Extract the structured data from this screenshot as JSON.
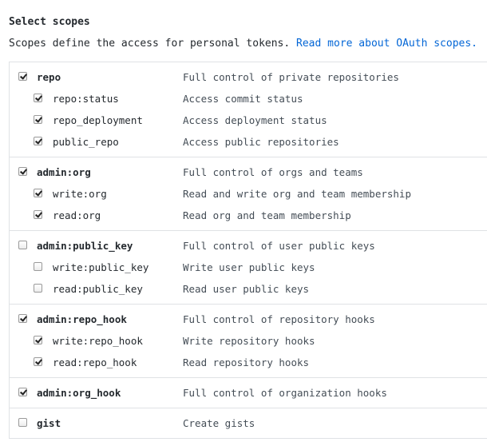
{
  "heading": "Select scopes",
  "description": {
    "text": "Scopes define the access for personal tokens.",
    "link": "Read more about OAuth scopes."
  },
  "scopes": [
    {
      "name": "repo",
      "description": "Full control of private repositories",
      "checked": true,
      "children": [
        {
          "name": "repo:status",
          "description": "Access commit status",
          "checked": true
        },
        {
          "name": "repo_deployment",
          "description": "Access deployment status",
          "checked": true
        },
        {
          "name": "public_repo",
          "description": "Access public repositories",
          "checked": true
        }
      ]
    },
    {
      "name": "admin:org",
      "description": "Full control of orgs and teams",
      "checked": true,
      "children": [
        {
          "name": "write:org",
          "description": "Read and write org and team membership",
          "checked": true
        },
        {
          "name": "read:org",
          "description": "Read org and team membership",
          "checked": true
        }
      ]
    },
    {
      "name": "admin:public_key",
      "description": "Full control of user public keys",
      "checked": false,
      "children": [
        {
          "name": "write:public_key",
          "description": "Write user public keys",
          "checked": false
        },
        {
          "name": "read:public_key",
          "description": "Read user public keys",
          "checked": false
        }
      ]
    },
    {
      "name": "admin:repo_hook",
      "description": "Full control of repository hooks",
      "checked": true,
      "children": [
        {
          "name": "write:repo_hook",
          "description": "Write repository hooks",
          "checked": true
        },
        {
          "name": "read:repo_hook",
          "description": "Read repository hooks",
          "checked": true
        }
      ]
    },
    {
      "name": "admin:org_hook",
      "description": "Full control of organization hooks",
      "checked": true,
      "children": []
    },
    {
      "name": "gist",
      "description": "Create gists",
      "checked": false,
      "children": []
    }
  ]
}
